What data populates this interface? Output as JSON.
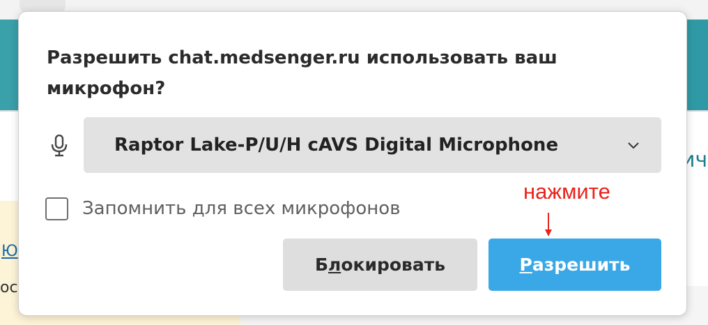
{
  "dialog": {
    "title": "Разрешить chat.medsenger.ru использовать ваш микрофон?",
    "device_select": {
      "selected": "Raptor Lake-P/U/H cAVS Digital Microphone",
      "icon": "chevron-down-icon"
    },
    "mic_icon": "microphone-icon",
    "remember_checkbox": {
      "label": "Запомнить для всех микрофонов",
      "checked": false
    },
    "block_button": {
      "first": "Б",
      "accel": "л",
      "rest": "окировать"
    },
    "allow_button": {
      "accel": "Р",
      "rest": "азрешить"
    }
  },
  "annotation": {
    "text": "нажмите",
    "color": "#e8231b",
    "arrow_icon": "arrow-down-icon"
  },
  "background": {
    "right_fragment": "ич",
    "left_link_fragment": "Ю",
    "left_text_fragment": "ос"
  },
  "colors": {
    "allow_button": "#3aa8e6",
    "block_button": "#dedede",
    "header_teal": "#3aa0aa"
  }
}
